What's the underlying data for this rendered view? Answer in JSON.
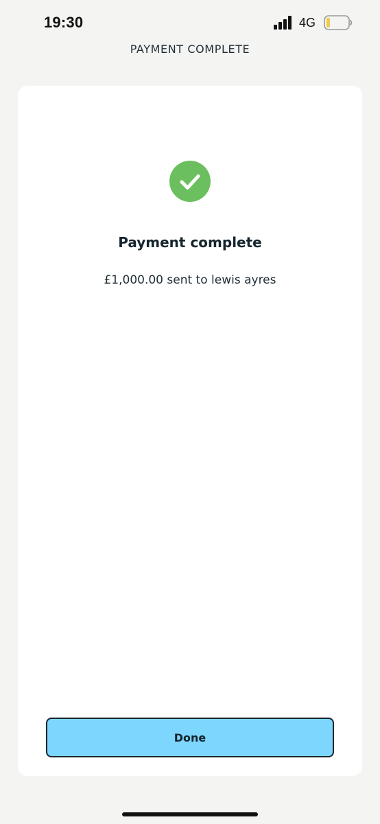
{
  "status_bar": {
    "time": "19:30",
    "network": "4G",
    "icons": [
      "signal-bars-icon",
      "battery-icon"
    ],
    "battery_color": "#f2c94c"
  },
  "nav": {
    "title": "PAYMENT COMPLETE"
  },
  "card": {
    "icon": "checkmark-circle-icon",
    "icon_color": "#6cbf5e",
    "heading": "Payment complete",
    "message": "£1,000.00 sent to lewis ayres"
  },
  "actions": {
    "done_label": "Done",
    "done_color": "#7dd6fd"
  }
}
